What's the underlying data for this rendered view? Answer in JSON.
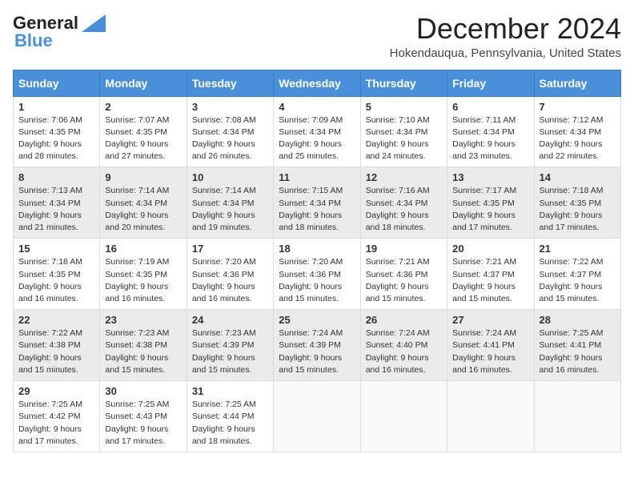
{
  "logo": {
    "line1": "General",
    "line2": "Blue"
  },
  "title": "December 2024",
  "subtitle": "Hokendauqua, Pennsylvania, United States",
  "days_of_week": [
    "Sunday",
    "Monday",
    "Tuesday",
    "Wednesday",
    "Thursday",
    "Friday",
    "Saturday"
  ],
  "weeks": [
    [
      {
        "day": 1,
        "sunrise": "7:06 AM",
        "sunset": "4:35 PM",
        "daylight": "9 hours and 28 minutes."
      },
      {
        "day": 2,
        "sunrise": "7:07 AM",
        "sunset": "4:35 PM",
        "daylight": "9 hours and 27 minutes."
      },
      {
        "day": 3,
        "sunrise": "7:08 AM",
        "sunset": "4:34 PM",
        "daylight": "9 hours and 26 minutes."
      },
      {
        "day": 4,
        "sunrise": "7:09 AM",
        "sunset": "4:34 PM",
        "daylight": "9 hours and 25 minutes."
      },
      {
        "day": 5,
        "sunrise": "7:10 AM",
        "sunset": "4:34 PM",
        "daylight": "9 hours and 24 minutes."
      },
      {
        "day": 6,
        "sunrise": "7:11 AM",
        "sunset": "4:34 PM",
        "daylight": "9 hours and 23 minutes."
      },
      {
        "day": 7,
        "sunrise": "7:12 AM",
        "sunset": "4:34 PM",
        "daylight": "9 hours and 22 minutes."
      }
    ],
    [
      {
        "day": 8,
        "sunrise": "7:13 AM",
        "sunset": "4:34 PM",
        "daylight": "9 hours and 21 minutes."
      },
      {
        "day": 9,
        "sunrise": "7:14 AM",
        "sunset": "4:34 PM",
        "daylight": "9 hours and 20 minutes."
      },
      {
        "day": 10,
        "sunrise": "7:14 AM",
        "sunset": "4:34 PM",
        "daylight": "9 hours and 19 minutes."
      },
      {
        "day": 11,
        "sunrise": "7:15 AM",
        "sunset": "4:34 PM",
        "daylight": "9 hours and 18 minutes."
      },
      {
        "day": 12,
        "sunrise": "7:16 AM",
        "sunset": "4:34 PM",
        "daylight": "9 hours and 18 minutes."
      },
      {
        "day": 13,
        "sunrise": "7:17 AM",
        "sunset": "4:35 PM",
        "daylight": "9 hours and 17 minutes."
      },
      {
        "day": 14,
        "sunrise": "7:18 AM",
        "sunset": "4:35 PM",
        "daylight": "9 hours and 17 minutes."
      }
    ],
    [
      {
        "day": 15,
        "sunrise": "7:18 AM",
        "sunset": "4:35 PM",
        "daylight": "9 hours and 16 minutes."
      },
      {
        "day": 16,
        "sunrise": "7:19 AM",
        "sunset": "4:35 PM",
        "daylight": "9 hours and 16 minutes."
      },
      {
        "day": 17,
        "sunrise": "7:20 AM",
        "sunset": "4:36 PM",
        "daylight": "9 hours and 16 minutes."
      },
      {
        "day": 18,
        "sunrise": "7:20 AM",
        "sunset": "4:36 PM",
        "daylight": "9 hours and 15 minutes."
      },
      {
        "day": 19,
        "sunrise": "7:21 AM",
        "sunset": "4:36 PM",
        "daylight": "9 hours and 15 minutes."
      },
      {
        "day": 20,
        "sunrise": "7:21 AM",
        "sunset": "4:37 PM",
        "daylight": "9 hours and 15 minutes."
      },
      {
        "day": 21,
        "sunrise": "7:22 AM",
        "sunset": "4:37 PM",
        "daylight": "9 hours and 15 minutes."
      }
    ],
    [
      {
        "day": 22,
        "sunrise": "7:22 AM",
        "sunset": "4:38 PM",
        "daylight": "9 hours and 15 minutes."
      },
      {
        "day": 23,
        "sunrise": "7:23 AM",
        "sunset": "4:38 PM",
        "daylight": "9 hours and 15 minutes."
      },
      {
        "day": 24,
        "sunrise": "7:23 AM",
        "sunset": "4:39 PM",
        "daylight": "9 hours and 15 minutes."
      },
      {
        "day": 25,
        "sunrise": "7:24 AM",
        "sunset": "4:39 PM",
        "daylight": "9 hours and 15 minutes."
      },
      {
        "day": 26,
        "sunrise": "7:24 AM",
        "sunset": "4:40 PM",
        "daylight": "9 hours and 16 minutes."
      },
      {
        "day": 27,
        "sunrise": "7:24 AM",
        "sunset": "4:41 PM",
        "daylight": "9 hours and 16 minutes."
      },
      {
        "day": 28,
        "sunrise": "7:25 AM",
        "sunset": "4:41 PM",
        "daylight": "9 hours and 16 minutes."
      }
    ],
    [
      {
        "day": 29,
        "sunrise": "7:25 AM",
        "sunset": "4:42 PM",
        "daylight": "9 hours and 17 minutes."
      },
      {
        "day": 30,
        "sunrise": "7:25 AM",
        "sunset": "4:43 PM",
        "daylight": "9 hours and 17 minutes."
      },
      {
        "day": 31,
        "sunrise": "7:25 AM",
        "sunset": "4:44 PM",
        "daylight": "9 hours and 18 minutes."
      },
      null,
      null,
      null,
      null
    ]
  ],
  "labels": {
    "sunrise": "Sunrise:",
    "sunset": "Sunset:",
    "daylight": "Daylight:"
  },
  "colors": {
    "header_bg": "#4a90d9",
    "row_even": "#ebebeb",
    "row_odd": "#ffffff"
  }
}
